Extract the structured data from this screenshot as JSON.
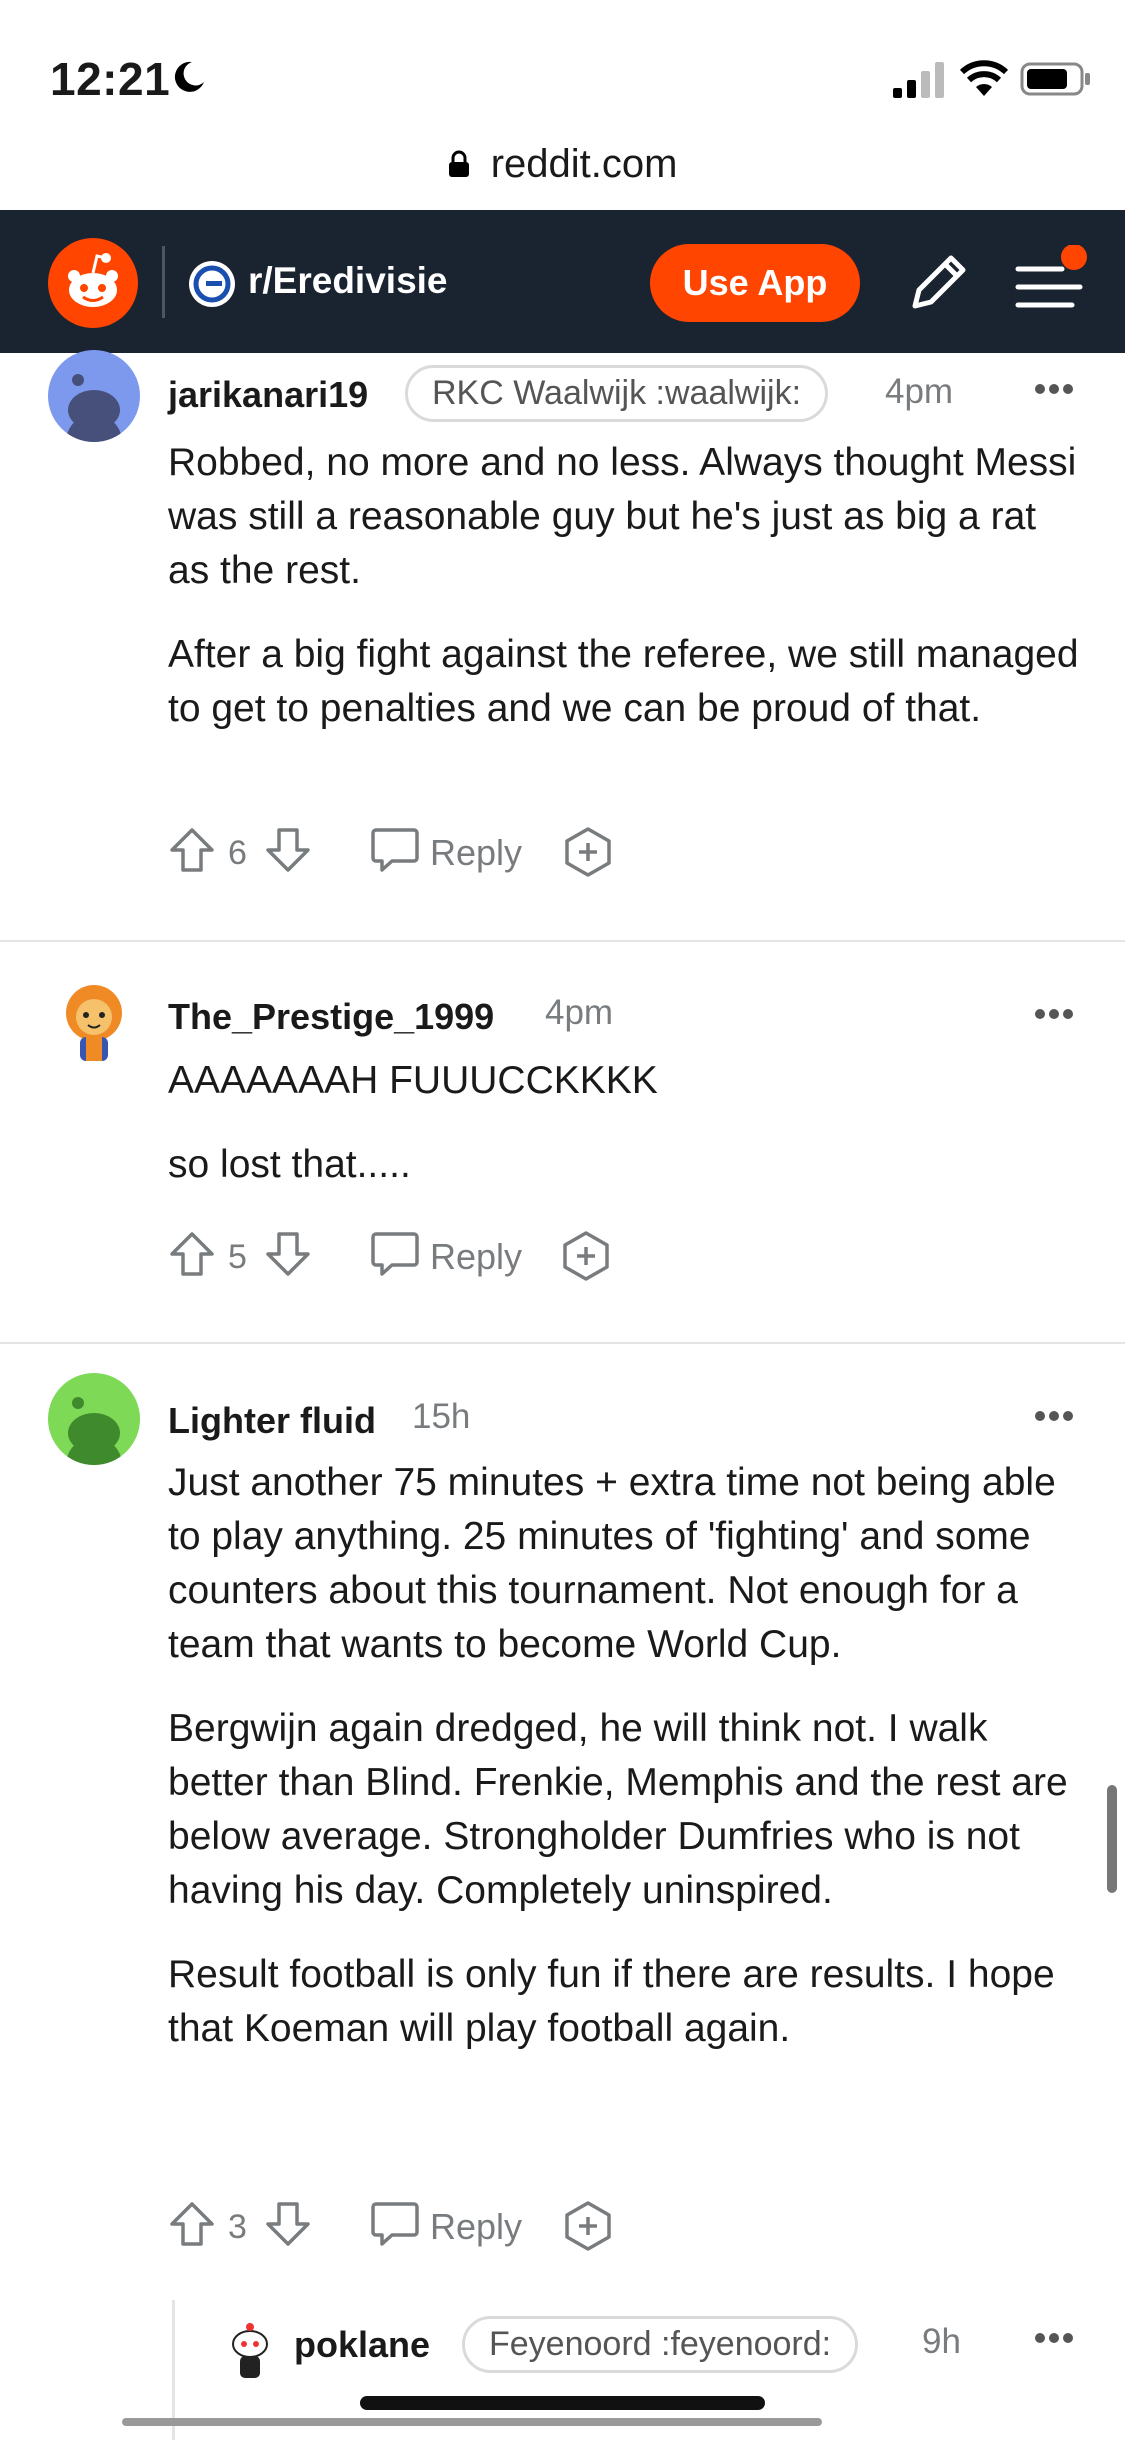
{
  "status_bar": {
    "time": "12:21"
  },
  "browser": {
    "url": "reddit.com"
  },
  "header": {
    "subreddit": "r/Eredivisie",
    "use_app_label": "Use App"
  },
  "colors": {
    "brand": "#ff4500",
    "header_bg": "#1a2330"
  },
  "comments": [
    {
      "username": "jarikanari19",
      "flair": "RKC Waalwijk :waalwijk:",
      "time": "4pm",
      "paragraphs": [
        "Robbed, no more and no less. Always thought Messi was still a reasonable guy but he's just as big a rat as the rest.",
        "After a big fight against the referee, we still managed to get to penalties and we can be proud of that."
      ],
      "votes": "6",
      "reply_label": "Reply"
    },
    {
      "username": "The_Prestige_1999",
      "time": "4pm",
      "paragraphs": [
        "AAAAAAAH FUUUCCKKKK",
        "so lost that....."
      ],
      "votes": "5",
      "reply_label": "Reply"
    },
    {
      "username": "Lighter fluid",
      "time": "15h",
      "paragraphs": [
        "Just another 75 minutes + extra time not being able to play anything. 25 minutes of 'fighting' and some counters about this tournament. Not enough for a team that wants to become World Cup.",
        "Bergwijn again dredged, he will think not. I walk better than Blind. Frenkie, Memphis and the rest are below average. Strongholder Dumfries who is not having his day. Completely uninspired.",
        "Result football is only fun if there are results. I hope that Koeman will play football again."
      ],
      "votes": "3",
      "reply_label": "Reply"
    },
    {
      "username": "poklane",
      "flair": "Feyenoord :feyenoord:",
      "time": "9h"
    }
  ]
}
